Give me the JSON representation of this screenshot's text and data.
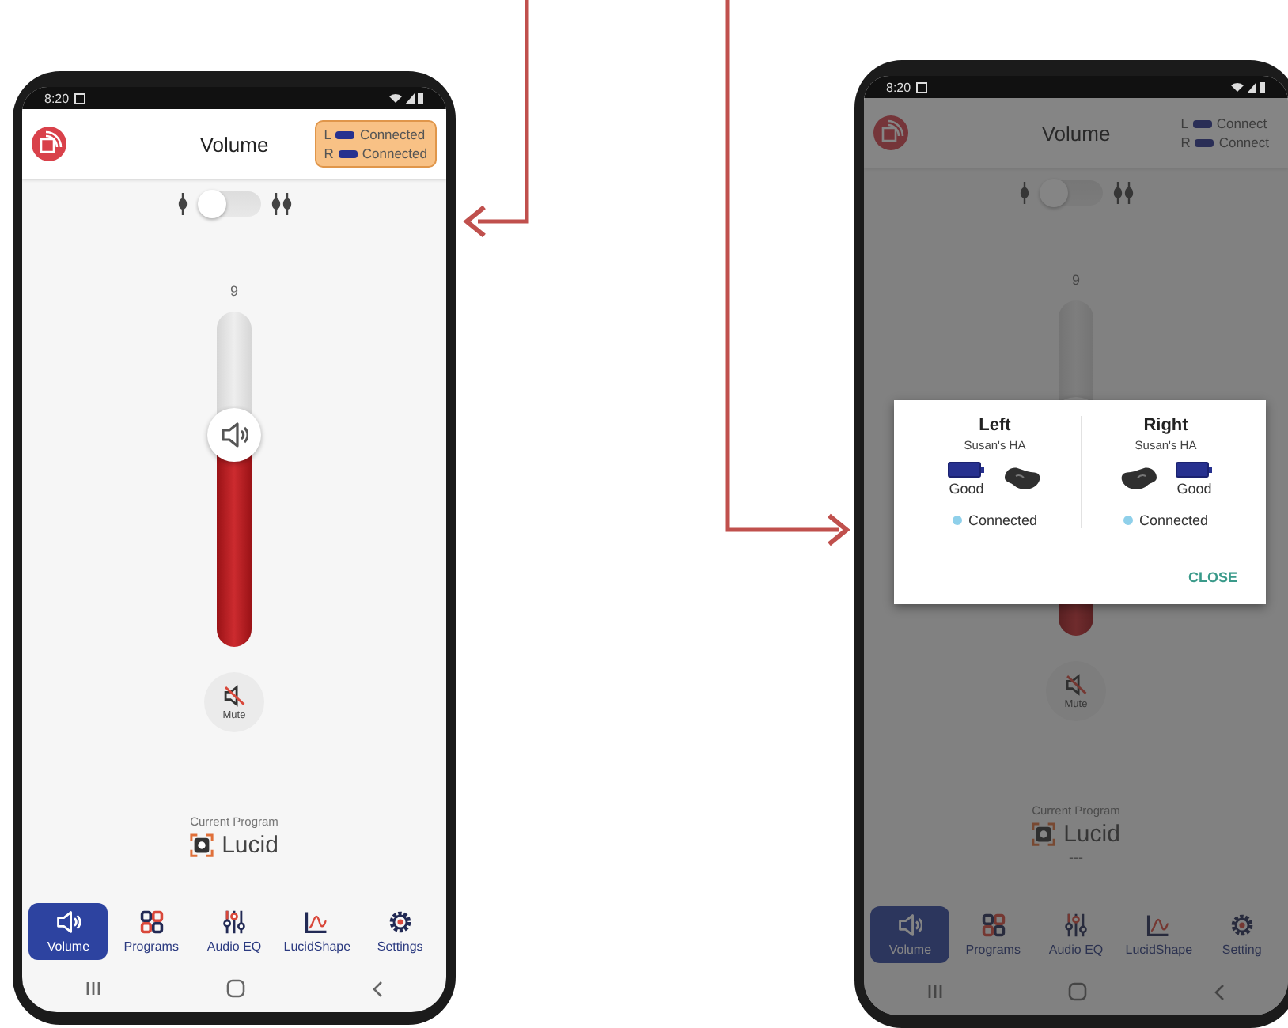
{
  "phones": [
    {
      "status_time": "8:20",
      "app_bar": {
        "title": "Volume",
        "connections_highlighted": true,
        "connections": [
          {
            "side": "L",
            "status": "Connected"
          },
          {
            "side": "R",
            "status": "Connected"
          }
        ]
      },
      "mode_toggle": {
        "on": false
      },
      "volume": {
        "reading": "9",
        "level": 0.63
      },
      "mute_button": {
        "label": "Mute"
      },
      "current_program": {
        "caption": "Current Program",
        "name": "Lucid"
      },
      "nav": [
        {
          "label": "Volume",
          "selected": true
        },
        {
          "label": "Programs",
          "selected": false
        },
        {
          "label": "Audio EQ",
          "selected": false
        },
        {
          "label": "LucidShape",
          "selected": false
        },
        {
          "label": "Settings",
          "selected": false
        }
      ]
    },
    {
      "status_time": "8:20",
      "app_bar": {
        "title": "Volume",
        "connections_highlighted": false,
        "connections": [
          {
            "side": "L",
            "status": "Connect"
          },
          {
            "side": "R",
            "status": "Connect"
          }
        ]
      },
      "mode_toggle": {
        "on": false
      },
      "volume": {
        "reading": "9",
        "level": 0.63
      },
      "mute_button": {
        "label": "Mute"
      },
      "current_program": {
        "caption": "Current Program",
        "name": "Lucid",
        "detail": "---"
      },
      "nav": [
        {
          "label": "Volume",
          "selected": true
        },
        {
          "label": "Programs",
          "selected": false
        },
        {
          "label": "Audio EQ",
          "selected": false
        },
        {
          "label": "LucidShape",
          "selected": false
        },
        {
          "label": "Setting",
          "selected": false
        }
      ],
      "dialog": {
        "devices": [
          {
            "kind": "battery_first",
            "title": "Left",
            "name": "Susan's HA",
            "battery": "Good",
            "status": "Connected"
          },
          {
            "kind": "aid_first",
            "title": "Right",
            "name": "Susan's HA",
            "battery": "Good",
            "status": "Connected"
          }
        ],
        "close_label": "CLOSE"
      }
    }
  ]
}
